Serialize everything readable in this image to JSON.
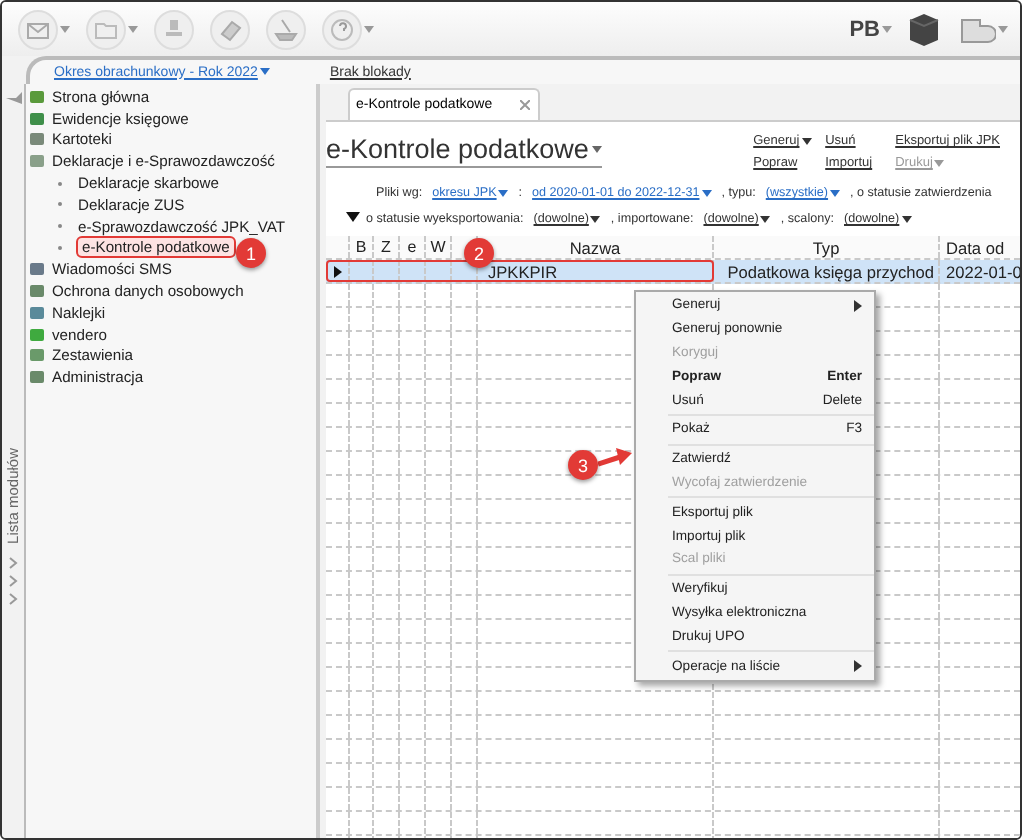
{
  "toolbar": {
    "user": "PB"
  },
  "period_bar": {
    "period": {
      "text": "Okres obrachunkowy - Rok 2022",
      "dropdown": true
    },
    "lock": {
      "text": "Brak blokady",
      "dropdown": false
    }
  },
  "module_strip": {
    "label": "Lista modułów"
  },
  "sidebar": {
    "items": [
      {
        "label": "Strona główna",
        "selected": false
      },
      {
        "label": "Ewidencje księgowe",
        "selected": false
      },
      {
        "label": "Kartoteki",
        "selected": false
      },
      {
        "label": "Deklaracje i e-Sprawozdawczość",
        "selected": false,
        "children": [
          {
            "label": "Deklaracje skarbowe",
            "selected": false
          },
          {
            "label": "Deklaracje ZUS",
            "selected": false
          },
          {
            "label": "e-Sprawozdawczość JPK_VAT",
            "selected": false
          },
          {
            "label": "e-Kontrole podatkowe",
            "selected": true
          }
        ]
      },
      {
        "label": "Wiadomości SMS",
        "selected": false
      },
      {
        "label": "Ochrona danych osobowych",
        "selected": false
      },
      {
        "label": "Naklejki",
        "selected": false
      },
      {
        "label": "vendero",
        "selected": false
      },
      {
        "label": "Zestawienia",
        "selected": false
      },
      {
        "label": "Administracja",
        "selected": false
      }
    ]
  },
  "tabs": [
    {
      "label": "e-Kontrole podatkowe",
      "selected": true
    }
  ],
  "title": "e-Kontrole podatkowe",
  "actions": [
    {
      "label": "Generuj",
      "dropdown": true,
      "disabled": false
    },
    {
      "label": "Popraw",
      "dropdown": false,
      "disabled": false
    },
    {
      "label": "Usuń",
      "dropdown": false,
      "disabled": false
    },
    {
      "label": "Importuj",
      "dropdown": false,
      "disabled": false
    },
    {
      "label": "Eksportuj plik JPK",
      "dropdown": false,
      "disabled": false
    },
    {
      "label": "Drukuj",
      "dropdown": true,
      "disabled": true
    }
  ],
  "filters": [
    [
      {
        "kind": "text",
        "text": "Pliki wg:"
      },
      {
        "kind": "link",
        "text": "okresu JPK"
      },
      {
        "kind": "text",
        "text": ":"
      },
      {
        "kind": "link",
        "text": "od 2020-01-01 do 2022-12-31"
      },
      {
        "kind": "text",
        "text": ", typu:"
      },
      {
        "kind": "link",
        "text": "(wszystkie)"
      },
      {
        "kind": "text",
        "text": ", o statusie zatwierdzenia"
      }
    ],
    [
      {
        "kind": "text",
        "text": "o statusie wyeksportowania:"
      },
      {
        "kind": "link",
        "text": "(dowolne)"
      },
      {
        "kind": "text",
        "text": ", importowane:"
      },
      {
        "kind": "link",
        "text": "(dowolne)"
      },
      {
        "kind": "text",
        "text": ", scalony:"
      },
      {
        "kind": "link",
        "text": "(dowolne)"
      }
    ]
  ],
  "table": {
    "flag_columns": [
      "B",
      "Z",
      "e",
      "W"
    ],
    "columns": [
      "Nazwa",
      "Typ",
      "Data od"
    ],
    "rows": [
      {
        "name": "JPKKPIR",
        "type": "Podatkowa księga przychod",
        "date_from": "2022-01-0",
        "selected": true
      }
    ]
  },
  "context_menu": [
    {
      "kind": "item",
      "label": "Generuj",
      "submenu": true,
      "disabled": false,
      "bold": false
    },
    {
      "kind": "item",
      "label": "Generuj ponownie",
      "submenu": false,
      "disabled": false,
      "bold": false
    },
    {
      "kind": "item",
      "label": "Koryguj",
      "submenu": false,
      "disabled": true,
      "bold": false
    },
    {
      "kind": "item",
      "label": "Popraw",
      "shortcut": "Enter",
      "submenu": false,
      "disabled": false,
      "bold": true
    },
    {
      "kind": "item",
      "label": "Usuń",
      "shortcut": "Delete",
      "submenu": false,
      "disabled": false,
      "bold": false
    },
    {
      "kind": "separator"
    },
    {
      "kind": "item",
      "label": "Pokaż",
      "shortcut": "F3",
      "submenu": false,
      "disabled": false,
      "bold": false
    },
    {
      "kind": "separator"
    },
    {
      "kind": "item",
      "label": "Zatwierdź",
      "submenu": false,
      "disabled": false,
      "bold": false
    },
    {
      "kind": "item",
      "label": "Wycofaj zatwierdzenie",
      "submenu": false,
      "disabled": true,
      "bold": false
    },
    {
      "kind": "separator"
    },
    {
      "kind": "item",
      "label": "Eksportuj plik",
      "submenu": false,
      "disabled": false,
      "bold": false
    },
    {
      "kind": "item",
      "label": "Importuj plik",
      "submenu": false,
      "disabled": false,
      "bold": false
    },
    {
      "kind": "item",
      "label": "Scal pliki",
      "submenu": false,
      "disabled": true,
      "bold": false
    },
    {
      "kind": "separator"
    },
    {
      "kind": "item",
      "label": "Weryfikuj",
      "submenu": false,
      "disabled": false,
      "bold": false
    },
    {
      "kind": "item",
      "label": "Wysyłka elektroniczna",
      "submenu": false,
      "disabled": false,
      "bold": false
    },
    {
      "kind": "item",
      "label": "Drukuj UPO",
      "submenu": false,
      "disabled": false,
      "bold": false
    },
    {
      "kind": "separator"
    },
    {
      "kind": "item",
      "label": "Operacje na liście",
      "submenu": true,
      "disabled": false,
      "bold": false
    }
  ],
  "annotations": [
    {
      "number": "1"
    },
    {
      "number": "2"
    },
    {
      "number": "3"
    }
  ]
}
